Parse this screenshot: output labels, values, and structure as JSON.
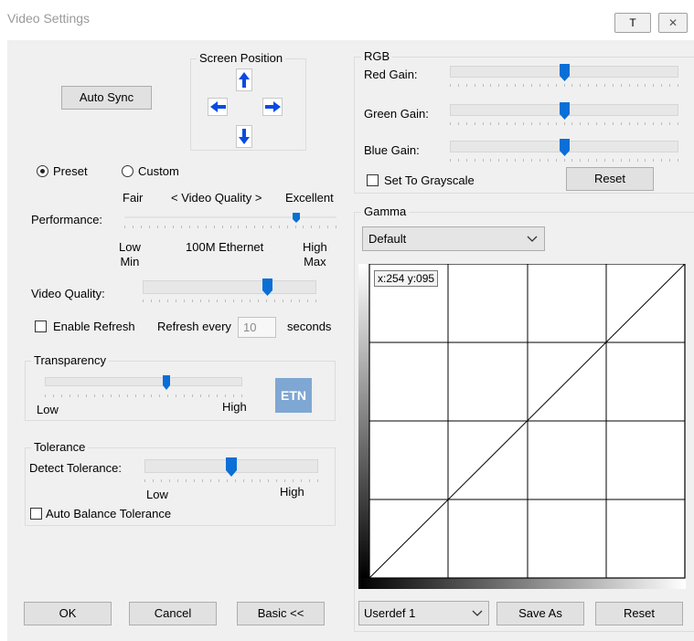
{
  "window": {
    "title": "Video Settings",
    "pin_label": "T",
    "close_label": "✕"
  },
  "auto_sync_label": "Auto Sync",
  "screen_position": {
    "legend": "Screen Position"
  },
  "mode": {
    "preset_label": "Preset",
    "custom_label": "Custom",
    "selected": "preset"
  },
  "performance": {
    "label": "Performance:",
    "top_left": "Fair",
    "top_center": "< Video Quality >",
    "top_right": "Excellent",
    "bottom_left": "Low\nMin",
    "bottom_center": "100M Ethernet",
    "bottom_right": "High\nMax",
    "value": 0.82
  },
  "video_quality": {
    "label": "Video Quality:",
    "value": 0.73
  },
  "refresh": {
    "enable_label": "Enable Refresh",
    "every_label": "Refresh every",
    "value": "10",
    "unit": "seconds"
  },
  "transparency": {
    "legend": "Transparency",
    "low": "Low",
    "high": "High",
    "value": 0.62
  },
  "logo_text": "ETN",
  "tolerance": {
    "legend": "Tolerance",
    "detect_label": "Detect Tolerance:",
    "low": "Low",
    "high": "High",
    "value": 0.5,
    "auto_balance_label": "Auto Balance Tolerance"
  },
  "rgb": {
    "legend": "RGB",
    "red_label": "Red Gain:",
    "red_value": 0.5,
    "green_label": "Green Gain:",
    "green_value": 0.5,
    "blue_label": "Blue Gain:",
    "blue_value": 0.5,
    "grayscale_label": "Set To Grayscale",
    "reset_label": "Reset"
  },
  "gamma": {
    "legend": "Gamma",
    "preset_value": "Default",
    "readout": "x:254 y:095",
    "user_preset_value": "Userdef 1",
    "save_as_label": "Save As",
    "reset_label": "Reset"
  },
  "footer": {
    "ok_label": "OK",
    "cancel_label": "Cancel",
    "basic_label": "Basic <<"
  },
  "colors": {
    "accent": "#0a6fd6",
    "thumb": "#0a6fd6",
    "logo_bg": "#7ea7d3",
    "arrow_blue": "#0a4be0"
  }
}
